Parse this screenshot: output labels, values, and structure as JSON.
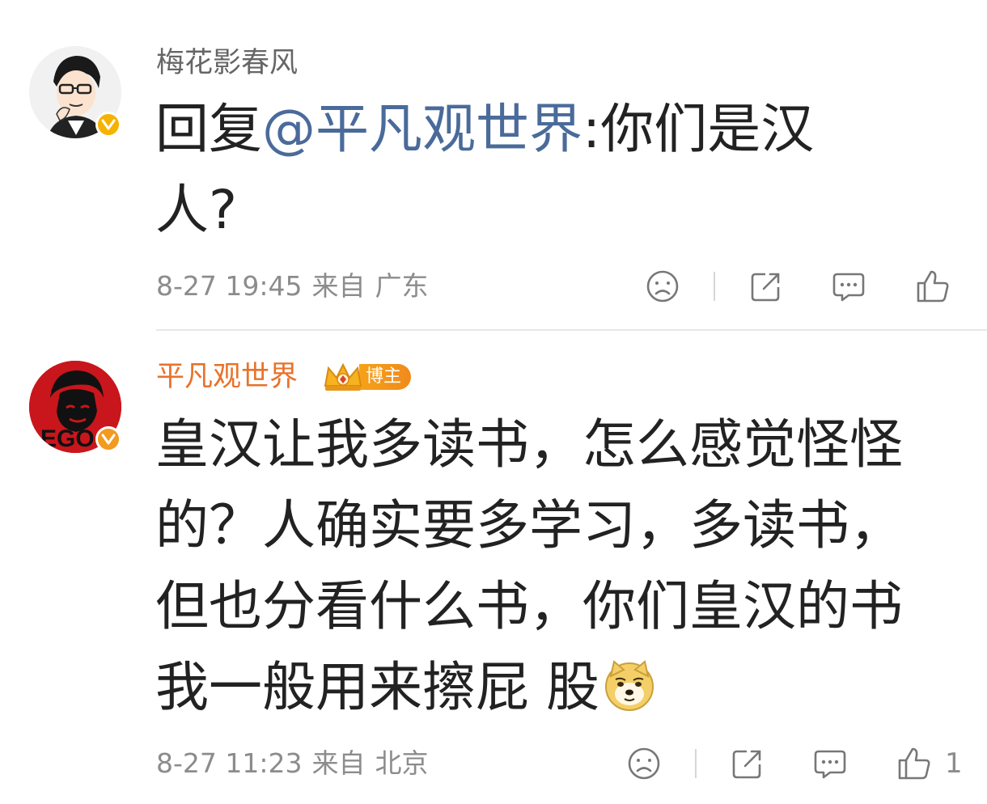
{
  "comments": [
    {
      "author": "梅花影春风",
      "content_prefix": "回复",
      "mention": "@平凡观世界",
      "content_line1_rest": ":你们是汉",
      "content_line2": "人?",
      "time": "8-27 19:45",
      "from_label": "来自",
      "location": "广东",
      "like_count": ""
    },
    {
      "author": "平凡观世界",
      "badge_label": "博主",
      "content_lines": [
        "皇汉让我多读书，怎么感觉怪怪",
        "的？人确实要多学习，多读书，",
        "但也分看什么书，你们皇汉的书",
        "我一般用来擦屁 股"
      ],
      "emoji": "doge-emoji",
      "time": "8-27 11:23",
      "from_label": "来自",
      "location": "北京",
      "like_count": "1"
    }
  ],
  "icons": {
    "dislike": "sad-face-icon",
    "share": "share-icon",
    "comment": "comment-icon",
    "like": "thumbs-up-icon"
  },
  "colors": {
    "mention": "#4a6b9a",
    "blogger_name": "#e8722a",
    "verified_gold": "#f5b300",
    "verified_orange": "#f39a1f",
    "meta_gray": "#8c8c8c"
  }
}
